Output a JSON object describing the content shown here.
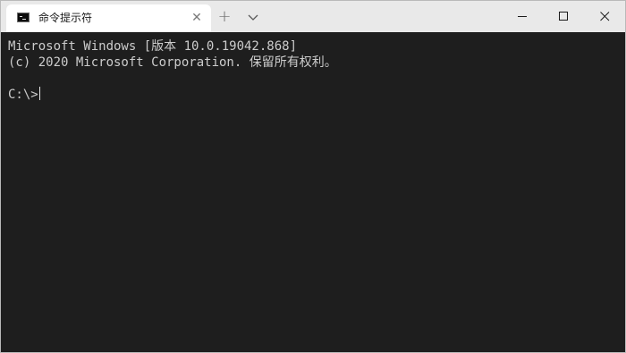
{
  "window": {
    "tab": {
      "icon": "console-icon",
      "title": "命令提示符",
      "close_glyph": "✕"
    },
    "new_tab_glyph": "+",
    "controls": [
      "minimize-icon",
      "maximize-icon",
      "close-icon"
    ]
  },
  "terminal": {
    "lines": [
      "Microsoft Windows [版本 10.0.19042.868]",
      "(c) 2020 Microsoft Corporation. 保留所有权利。",
      "",
      "C:\\>"
    ]
  },
  "colors": {
    "terminal_bg": "#1e1e1e",
    "terminal_fg": "#cccccc",
    "titlebar_bg": "#e9e9e9",
    "tab_bg": "#ffffff"
  }
}
